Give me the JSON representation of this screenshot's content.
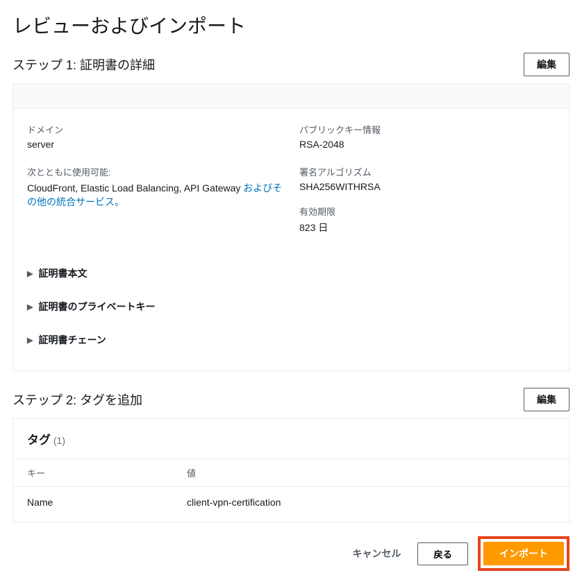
{
  "page": {
    "title": "レビューおよびインポート"
  },
  "step1": {
    "title": "ステップ 1: 証明書の詳細",
    "editLabel": "編集",
    "details": {
      "domainLabel": "ドメイン",
      "domainValue": "server",
      "publicKeyLabel": "パブリックキー情報",
      "publicKeyValue": "RSA-2048",
      "usableWithLabel": "次とともに使用可能:",
      "usableWithValue": "CloudFront, Elastic Load Balancing, API Gateway ",
      "usableWithLink": "およびその他の統合サービス。",
      "signatureAlgoLabel": "署名アルゴリズム",
      "signatureAlgoValue": "SHA256WITHRSA",
      "expirationLabel": "有効期限",
      "expirationValue": "823 日"
    },
    "expanders": {
      "certBody": "証明書本文",
      "privateKey": "証明書のプライベートキー",
      "certChain": "証明書チェーン"
    }
  },
  "step2": {
    "title": "ステップ 2: タグを追加",
    "editLabel": "編集",
    "tagsTitle": "タグ",
    "tagsCount": "(1)",
    "columns": {
      "key": "キー",
      "value": "値"
    },
    "rows": [
      {
        "key": "Name",
        "value": "client-vpn-certification"
      }
    ]
  },
  "footer": {
    "cancel": "キャンセル",
    "back": "戻る",
    "import": "インポート"
  }
}
